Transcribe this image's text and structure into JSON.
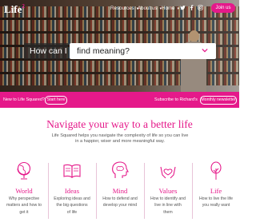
{
  "header": {
    "logo": "Life",
    "logo_mark": "2",
    "nav": [
      {
        "label": "Resources",
        "has_caret": true
      },
      {
        "label": "About us",
        "has_caret": true
      },
      {
        "label": "Home",
        "has_caret": true
      }
    ],
    "social_icons": [
      "twitter-icon",
      "facebook-icon",
      "instagram-icon"
    ],
    "join_label": "Join us"
  },
  "hero": {
    "prompt": "How can I",
    "search_value": "find meaning?",
    "chevron_icon": "chevron-down-icon"
  },
  "subscribe_bar": {
    "left_text": "New to Life Squared?",
    "left_button": "Start here",
    "right_text": "Subscribe to Richard's",
    "right_button": "Monthly newsletter"
  },
  "main": {
    "headline": "Navigate your way to a better life",
    "intro": "Life Squared helps you navigate the complexity of life so you can live in a happier, wiser and more meaningful way.",
    "cards": [
      {
        "title": "World",
        "desc_1": "Why perspective",
        "desc_2": "matters and how to",
        "desc_3": "get it",
        "icon": "globe-icon"
      },
      {
        "title": "Ideas",
        "desc_1": "Exploring ideas and",
        "desc_2": "the big questions",
        "desc_3": "of life",
        "icon": "open-book-icon"
      },
      {
        "title": "Mind",
        "desc_1": "How to defend and",
        "desc_2": "develop your mind",
        "desc_3": "",
        "icon": "brain-head-icon"
      },
      {
        "title": "Values",
        "desc_1": "How to identify and",
        "desc_2": "live in line with",
        "desc_3": "them",
        "icon": "heart-hands-icon"
      },
      {
        "title": "Life",
        "desc_1": "How to live the life",
        "desc_2": "you really want",
        "desc_3": "",
        "icon": "tree-icon"
      }
    ]
  },
  "colors": {
    "accent": "#e5198a",
    "text": "#555555"
  }
}
